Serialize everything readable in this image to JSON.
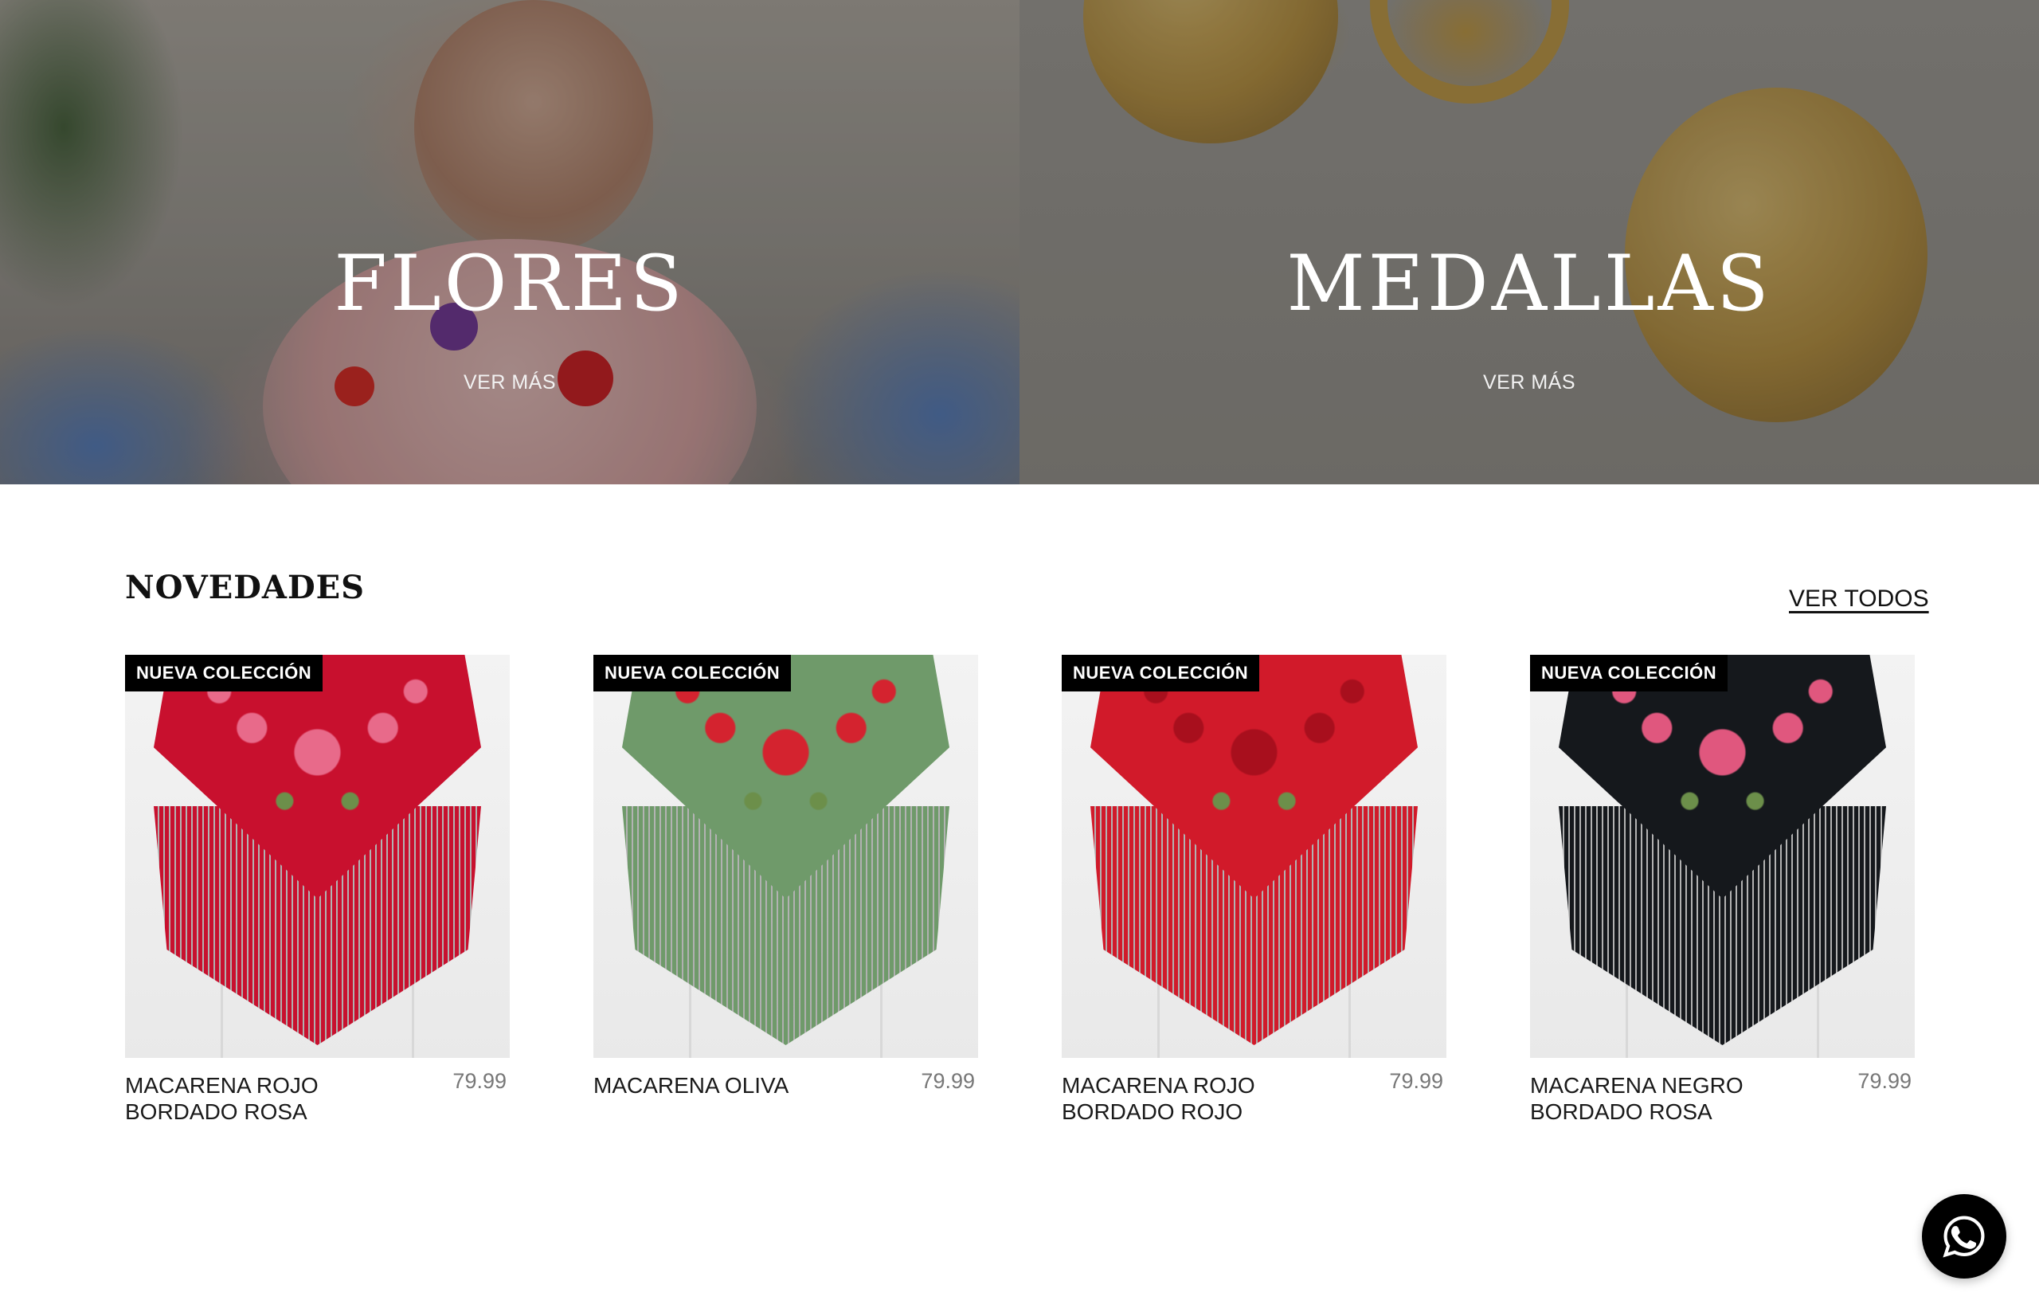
{
  "hero": {
    "banners": [
      {
        "title": "FLORES",
        "link_label": "VER MÁS"
      },
      {
        "title": "MEDALLAS",
        "link_label": "VER MÁS"
      }
    ]
  },
  "novedades": {
    "title": "NOVEDADES",
    "view_all_label": "VER TODOS",
    "products": [
      {
        "badge": "NUEVA COLECCIÓN",
        "name": "MACARENA ROJO BORDADO ROSA",
        "price": "79.99",
        "base_color": "#c8102e",
        "flower_color": "#e86a8a"
      },
      {
        "badge": "NUEVA COLECCIÓN",
        "name": "MACARENA OLIVA",
        "price": "79.99",
        "base_color": "#6f9a6a",
        "flower_color": "#d4232f"
      },
      {
        "badge": "NUEVA COLECCIÓN",
        "name": "MACARENA ROJO BORDADO ROJO",
        "price": "79.99",
        "base_color": "#d11a2a",
        "flower_color": "#a80f1d"
      },
      {
        "badge": "NUEVA COLECCIÓN",
        "name": "MACARENA NEGRO BORDADO ROSA",
        "price": "79.99",
        "base_color": "#15181c",
        "flower_color": "#e0577e"
      }
    ]
  },
  "whatsapp": {
    "icon": "whatsapp-icon"
  }
}
